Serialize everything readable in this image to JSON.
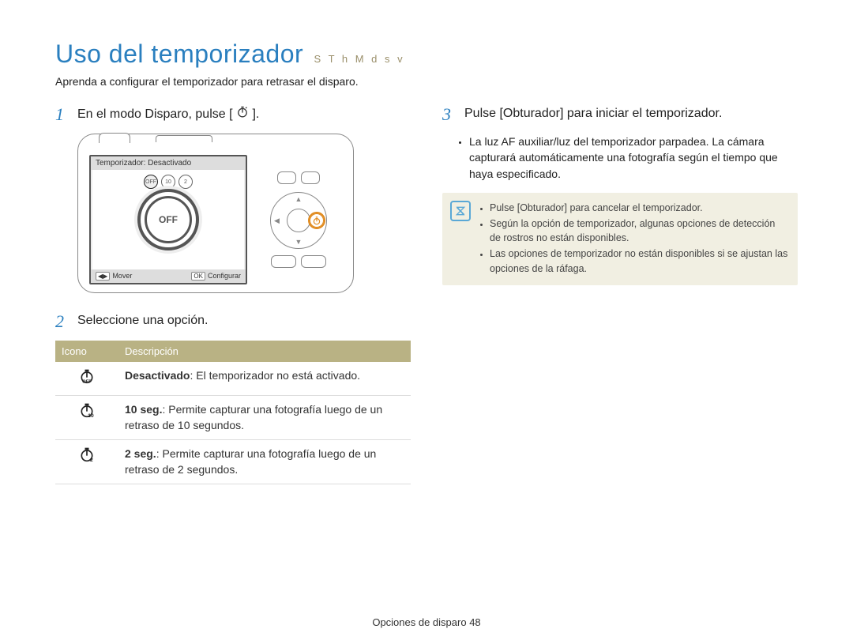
{
  "title": "Uso del temporizador",
  "title_modes": "S T h M d s v",
  "intro": "Aprenda a conﬁgurar el temporizador para retrasar el disparo.",
  "left": {
    "step1_num": "1",
    "step1_text_a": "En el modo Disparo, pulse [",
    "step1_text_b": "].",
    "step2_num": "2",
    "step2_text": "Seleccione una opción.",
    "screen_title": "Temporizador: Desactivado",
    "screen_off": "OFF",
    "mini_off": "OFF",
    "mini_10": "10",
    "mini_2": "2",
    "foot_move": "Mover",
    "foot_set": "Conﬁgurar",
    "foot_ok": "OK",
    "table": {
      "h_icon": "Icono",
      "h_desc": "Descripción",
      "r1_label": "Desactivado",
      "r1_desc": ": El temporizador no está activado.",
      "r2_label": "10 seg.",
      "r2_desc": ": Permite capturar una fotografía luego de un retraso de 10 segundos.",
      "r3_label": "2 seg.",
      "r3_desc": ": Permite capturar una fotografía luego de un retraso de 2 segundos."
    }
  },
  "right": {
    "step3_num": "3",
    "step3_text": "Pulse [Obturador] para iniciar el temporizador.",
    "bullet1": "La luz AF auxiliar/luz del temporizador parpadea. La cámara capturará automáticamente una fotografía según el tiempo que haya especiﬁcado.",
    "note1": "Pulse [Obturador] para cancelar el temporizador.",
    "note2": "Según la opción de temporizador, algunas opciones de detección de rostros no están disponibles.",
    "note3": "Las opciones de temporizador no están disponibles si se ajustan las opciones de la ráfaga."
  },
  "footer_section": "Opciones de disparo",
  "footer_page": "48"
}
